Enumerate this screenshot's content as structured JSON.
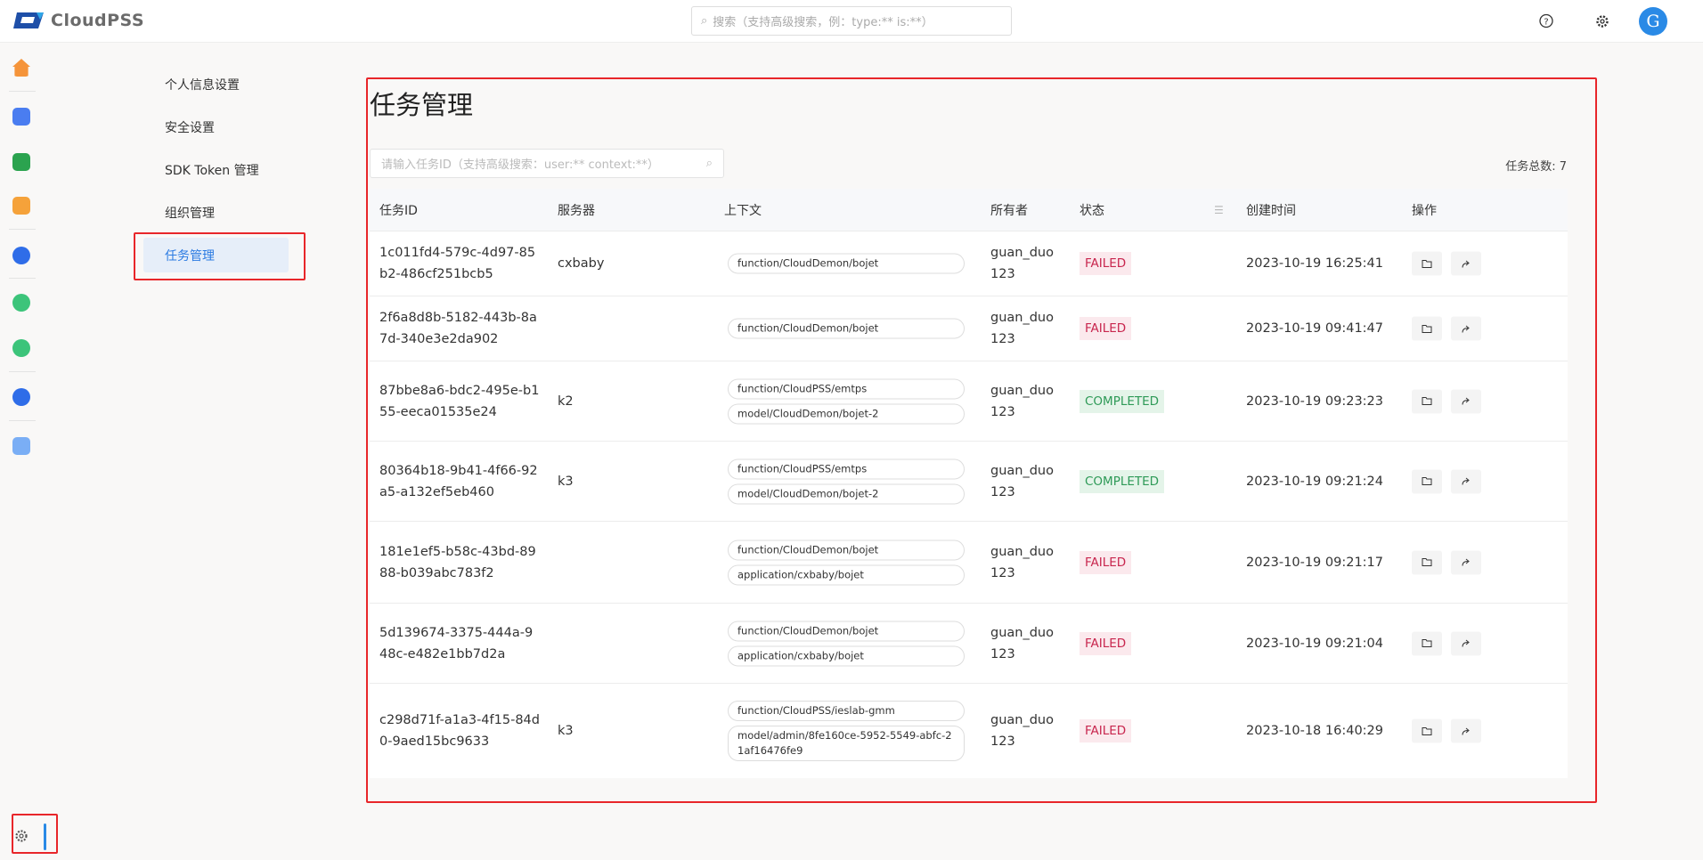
{
  "header": {
    "logo_text": "CloudPSS",
    "search_placeholder": "搜索（支持高级搜索，例：type:** is:**）",
    "avatar_letter": "G"
  },
  "rail": {
    "icons": [
      "home-icon",
      "chart-app-icon",
      "function-app-icon",
      "trend-app-icon",
      "simulation-app-icon",
      "ies-app-icon",
      "ies-lab-icon",
      "data-app-icon",
      "document-icon"
    ],
    "colors": [
      "#f5943a",
      "#4a7df0",
      "#2ba34f",
      "#f5a23a",
      "#2f6de8",
      "#3cc47a",
      "#3cc47a",
      "#2f6de8",
      "#7aaef5"
    ]
  },
  "subnav": {
    "items": [
      {
        "label": "个人信息设置"
      },
      {
        "label": "安全设置"
      },
      {
        "label": "SDK Token 管理"
      },
      {
        "label": "组织管理"
      },
      {
        "label": "任务管理",
        "active": true
      }
    ]
  },
  "main": {
    "title": "任务管理",
    "search_placeholder": "请输入任务ID（支持高级搜索：user:** context:**）",
    "total": "任务总数: 7",
    "columns": [
      "任务ID",
      "服务器",
      "上下文",
      "所有者",
      "状态",
      "创建时间",
      "操作"
    ],
    "rows": [
      {
        "id": "1c011fd4-579c-4d97-85b2-486cf251bcb5",
        "server": "cxbaby",
        "context": [
          "function/CloudDemon/bojet"
        ],
        "owner": "guan_duo123",
        "status": "FAILED",
        "time": "2023-10-19 16:25:41"
      },
      {
        "id": "2f6a8d8b-5182-443b-8a7d-340e3e2da902",
        "server": "",
        "context": [
          "function/CloudDemon/bojet"
        ],
        "owner": "guan_duo123",
        "status": "FAILED",
        "time": "2023-10-19 09:41:47"
      },
      {
        "id": "87bbe8a6-bdc2-495e-b155-eeca01535e24",
        "server": "k2",
        "context": [
          "function/CloudPSS/emtps",
          "model/CloudDemon/bojet-2"
        ],
        "owner": "guan_duo123",
        "status": "COMPLETED",
        "time": "2023-10-19 09:23:23"
      },
      {
        "id": "80364b18-9b41-4f66-92a5-a132ef5eb460",
        "server": "k3",
        "context": [
          "function/CloudPSS/emtps",
          "model/CloudDemon/bojet-2"
        ],
        "owner": "guan_duo123",
        "status": "COMPLETED",
        "time": "2023-10-19 09:21:24"
      },
      {
        "id": "181e1ef5-b58c-43bd-8988-b039abc783f2",
        "server": "",
        "context": [
          "function/CloudDemon/bojet",
          "application/cxbaby/bojet"
        ],
        "owner": "guan_duo123",
        "status": "FAILED",
        "time": "2023-10-19 09:21:17"
      },
      {
        "id": "5d139674-3375-444a-948c-e482e1bb7d2a",
        "server": "",
        "context": [
          "function/CloudDemon/bojet",
          "application/cxbaby/bojet"
        ],
        "owner": "guan_duo123",
        "status": "FAILED",
        "time": "2023-10-19 09:21:04"
      },
      {
        "id": "c298d71f-a1a3-4f15-84d0-9aed15bc9633",
        "server": "k3",
        "context": [
          "function/CloudPSS/ieslab-gmm",
          "model/admin/8fe160ce-5952-5549-abfc-21af16476fe9"
        ],
        "owner": "guan_duo123",
        "status": "FAILED",
        "time": "2023-10-18 16:40:29"
      }
    ]
  },
  "colors": {
    "accent": "#2a8ae6",
    "failed": "#c8264e",
    "completed": "#2e9a57",
    "annotation": "#e8262a"
  }
}
